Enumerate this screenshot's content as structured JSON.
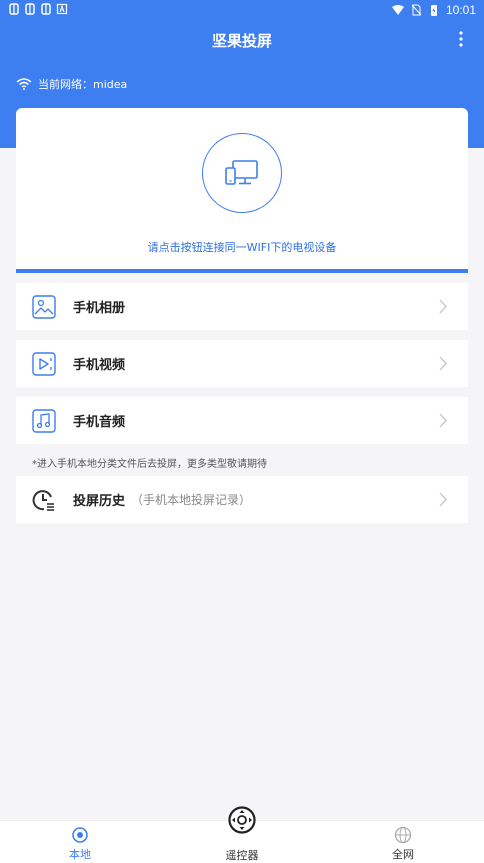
{
  "status_bar": {
    "time": "10:01"
  },
  "header": {
    "title": "坚果投屏"
  },
  "network": {
    "label": "当前网络：midea"
  },
  "hero": {
    "hint": "请点击按钮连接同一WIFI下的电视设备"
  },
  "menu": [
    {
      "label": "手机相册",
      "icon": "photo-album-icon"
    },
    {
      "label": "手机视频",
      "icon": "video-icon"
    },
    {
      "label": "手机音频",
      "icon": "music-icon"
    }
  ],
  "note": "*进入手机本地分类文件后去投屏，更多类型敬请期待",
  "history": {
    "label": "投屏历史",
    "sub": "（手机本地投屏记录）"
  },
  "tabs": [
    {
      "label": "本地",
      "active": true
    },
    {
      "label": "遥控器",
      "active": false
    },
    {
      "label": "全网",
      "active": false
    }
  ],
  "colors": {
    "accent": "#3d7ef0",
    "background": "#f5f5f7"
  }
}
